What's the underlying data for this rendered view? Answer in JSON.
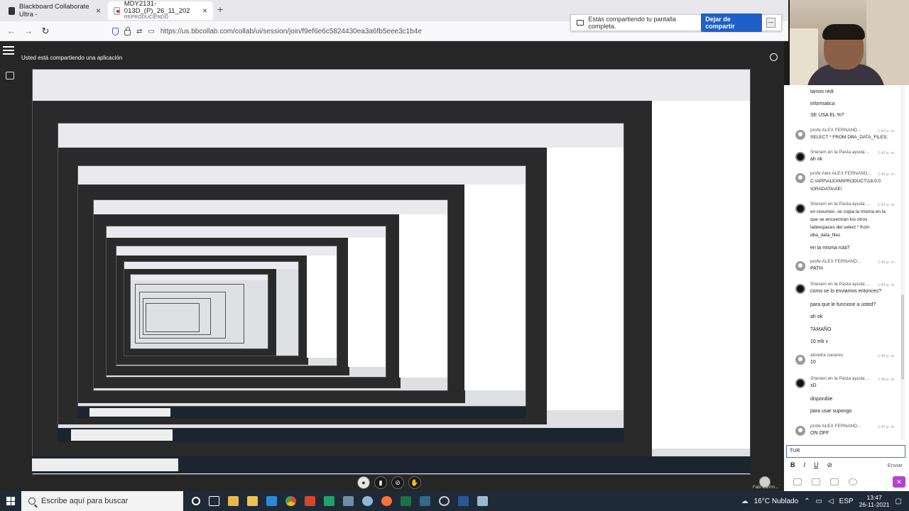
{
  "browser": {
    "tabs": [
      {
        "title": "Blackboard Collaborate Ultra - ",
        "subtitle": ""
      },
      {
        "title": "MDY2131-013D_(P)_26_11_202",
        "subtitle": "REPRODUCIENDO"
      }
    ],
    "url": "https://us.bbcollab.com/collab/ui/session/join/f9ef6e6c5824430ea3a6fb5eee3c1b4e"
  },
  "share_bar": {
    "message": "Estás compartiendo tu pantalla completa.",
    "stop_label": "Dejar de compartir"
  },
  "sharing_notice": "Usted está compartiendo una aplicación",
  "chat": {
    "messages": [
      {
        "text": "tamos redi",
        "time": ""
      },
      {
        "text": "informatica",
        "time": ""
      },
      {
        "text": "SE USA EL %?",
        "time": ""
      },
      {
        "sender": "profe ALEX FERNAND...",
        "time": "1:42 p. m.",
        "text": "SELECT * FROM DBA_DATA_FILES;",
        "avatar": "grey"
      },
      {
        "sender": "Sheram en la Pasta ayuda ...",
        "time": "1:42 p. m.",
        "text": "ah ok",
        "avatar": "dark"
      },
      {
        "sender": "profe Alex ALEX FERNAND...",
        "time": "1:43 p. m.",
        "text": "C:\\APP\\ALEXM\\PRODUCT\\18.0.0\n\\ORADATA\\XE\\",
        "avatar": "grey"
      },
      {
        "sender": "Sheram en la Pasta ayuda ...",
        "time": "1:43 p. m.",
        "text": "en resumen, se copia la misma en la\nque se encuentran los otros\ntablespaces del select * from\ndba_data_files",
        "avatar": "dark"
      },
      {
        "text": "en la misma ruta?",
        "time": ""
      },
      {
        "sender": "profe ALEX FERNAND...",
        "time": "1:43 p. m.",
        "text": "PATH",
        "avatar": "grey"
      },
      {
        "sender": "Sheram en la Pasta ayuda ...",
        "time": "1:43 p. m.",
        "text": "como se lo enviamos entonces?",
        "avatar": "dark"
      },
      {
        "text": "para que le funcione a usted?",
        "time": ""
      },
      {
        "text": "ah ok",
        "time": ""
      },
      {
        "text": "TAMAÑO",
        "time": ""
      },
      {
        "text": "10 mb x",
        "time": ""
      },
      {
        "sender": "alondra caceres",
        "time": "1:46 p. m.",
        "text": "10",
        "avatar": "grey"
      },
      {
        "sender": "Sheram en la Pasta ayuda ...",
        "time": "1:46 p. m.",
        "text": "xD",
        "avatar": "dark"
      },
      {
        "text": "disponible",
        "time": ""
      },
      {
        "text": "para usar supongo",
        "time": ""
      },
      {
        "sender": "profe ALEX FERNAND...",
        "time": "1:47 p. m.",
        "text": "ON OFF",
        "avatar": "grey"
      }
    ],
    "input_value": "TUR",
    "send_label": "Enviar",
    "toolbar": {
      "bold": "B",
      "italic": "I",
      "underline": "U",
      "link": "⊘"
    }
  },
  "participant_name": "Fabi Carrim...",
  "taskbar": {
    "search_placeholder": "Escribe aquí para buscar",
    "weather": "16°C  Nublado",
    "lang": "ESP",
    "time": "13:47",
    "date": "26-11-2021"
  },
  "colors": {
    "accent": "#1f5fc7",
    "purple": "#b443ce",
    "taskbar": "#1f2a37"
  }
}
